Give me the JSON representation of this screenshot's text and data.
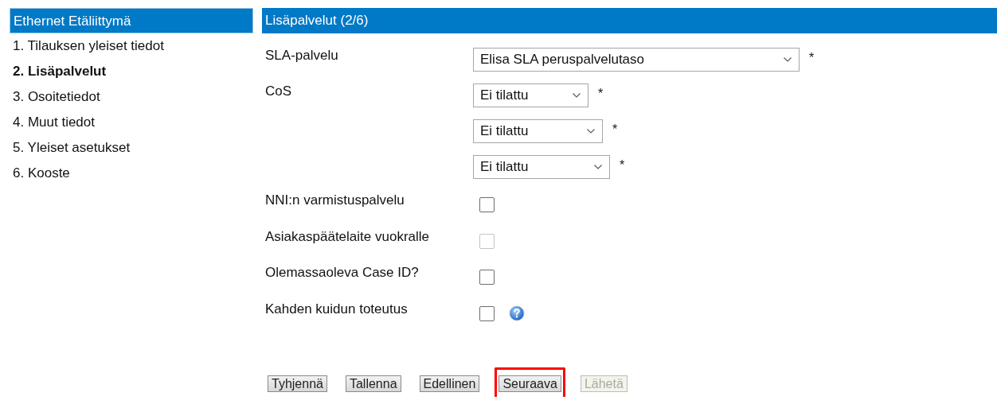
{
  "sidebar": {
    "title": "Ethernet Etäliittymä",
    "items": [
      {
        "label": "1. Tilauksen yleiset tiedot",
        "selected": false
      },
      {
        "label": "2. Lisäpalvelut",
        "selected": true
      },
      {
        "label": "3. Osoitetiedot",
        "selected": false
      },
      {
        "label": "4. Muut tiedot",
        "selected": false
      },
      {
        "label": "5. Yleiset asetukset",
        "selected": false
      },
      {
        "label": "6. Kooste",
        "selected": false
      }
    ]
  },
  "form": {
    "title": "Lisäpalvelut (2/6)",
    "rows": [
      {
        "kind": "select",
        "label": "SLA-palvelu",
        "value": "Elisa SLA peruspalvelutaso",
        "required": "*"
      },
      {
        "kind": "select",
        "label": "CoS",
        "value": "Ei tilattu",
        "required": "*"
      },
      {
        "kind": "select",
        "value": "Ei tilattu",
        "required": "*"
      },
      {
        "kind": "select",
        "value": "Ei tilattu",
        "required": "*"
      },
      {
        "kind": "checkbox",
        "label": "NNI:n varmistuspalvelu",
        "checked": false,
        "disabled": false
      },
      {
        "kind": "checkbox",
        "label": "Asiakaspäätelaite vuokralle",
        "checked": false,
        "disabled": true
      },
      {
        "kind": "checkbox",
        "label": "Olemassaoleva Case ID?",
        "checked": false,
        "disabled": false
      },
      {
        "kind": "checkbox",
        "label": "Kahden kuidun toteutus",
        "checked": false,
        "disabled": false,
        "help": true
      }
    ]
  },
  "buttons": [
    {
      "label": "Tyhjennä",
      "disabled": false,
      "highlighted": false
    },
    {
      "label": "Tallenna",
      "disabled": false,
      "highlighted": false
    },
    {
      "label": "Edellinen",
      "disabled": false,
      "highlighted": false
    },
    {
      "label": "Seuraava",
      "disabled": false,
      "highlighted": true
    },
    {
      "label": "Lähetä",
      "disabled": true,
      "highlighted": false
    }
  ]
}
